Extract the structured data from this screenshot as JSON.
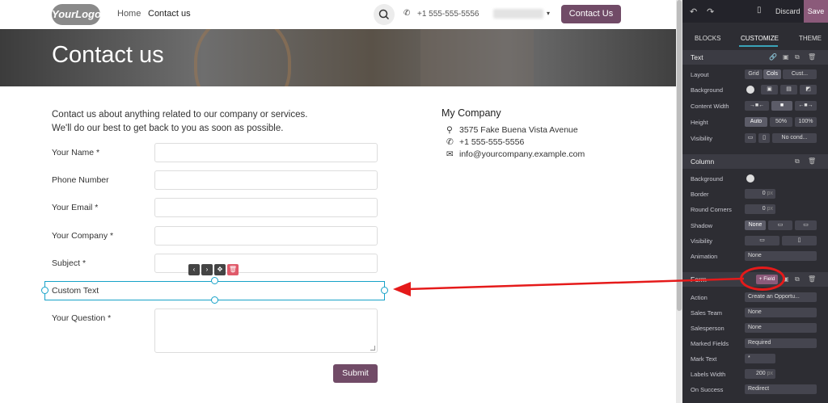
{
  "header": {
    "logo": "YourLogo",
    "nav": [
      "Home",
      "Contact us"
    ],
    "phone": "+1 555-555-5556",
    "caret": "▾",
    "cta": "Contact Us"
  },
  "banner": {
    "title": "Contact us"
  },
  "intro": {
    "line1": "Contact us about anything related to our company or services.",
    "line2": "We'll do our best to get back to you as soon as possible."
  },
  "form": {
    "fields": [
      {
        "label": "Your Name *"
      },
      {
        "label": "Phone Number"
      },
      {
        "label": "Your Email *"
      },
      {
        "label": "Your Company *"
      },
      {
        "label": "Subject *"
      },
      {
        "label": "Custom Text"
      },
      {
        "label": "Your Question *"
      }
    ],
    "submit": "Submit"
  },
  "company": {
    "name": "My Company",
    "address": "3575 Fake Buena Vista Avenue",
    "phone": "+1 555-555-5556",
    "email": "info@yourcompany.example.com"
  },
  "panel": {
    "top": {
      "discard": "Discard",
      "save": "Save"
    },
    "tabs": [
      "BLOCKS",
      "CUSTOMIZE",
      "THEME"
    ],
    "text_section": {
      "title": "Text",
      "layout": {
        "label": "Layout",
        "opts": [
          "Grid",
          "Cols",
          "Cust..."
        ]
      },
      "background": "Background",
      "content_width": "Content Width",
      "height": {
        "label": "Height",
        "opts": [
          "Auto",
          "50%",
          "100%"
        ]
      },
      "visibility": {
        "label": "Visibility",
        "value": "No cond..."
      }
    },
    "column_section": {
      "title": "Column",
      "background": "Background",
      "border": {
        "label": "Border",
        "value": "0",
        "unit": "px"
      },
      "round_corners": {
        "label": "Round Corners",
        "value": "0",
        "unit": "px"
      },
      "shadow": {
        "label": "Shadow",
        "value": "None"
      },
      "visibility": "Visibility",
      "animation": {
        "label": "Animation",
        "value": "None"
      }
    },
    "form_section": {
      "title": "Form",
      "field_btn": "+ Field",
      "action": {
        "label": "Action",
        "value": "Create an Opportu..."
      },
      "sales_team": {
        "label": "Sales Team",
        "value": "None"
      },
      "salesperson": {
        "label": "Salesperson",
        "value": "None"
      },
      "marked_fields": {
        "label": "Marked Fields",
        "value": "Required"
      },
      "mark_text": {
        "label": "Mark Text",
        "value": "*"
      },
      "labels_width": {
        "label": "Labels Width",
        "value": "200",
        "unit": "px"
      },
      "on_success": {
        "label": "On Success",
        "value": "Redirect"
      }
    }
  },
  "colors": {
    "accent": "#714b67",
    "panel_bg": "#2d2d33",
    "selection": "#17a2c8",
    "annotation": "#e51a1a"
  }
}
